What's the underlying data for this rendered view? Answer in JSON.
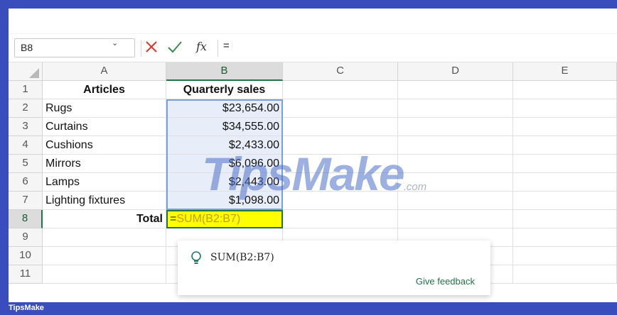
{
  "formula_bar": {
    "name_box": "B8",
    "formula": "="
  },
  "columns": [
    "A",
    "B",
    "C",
    "D",
    "E"
  ],
  "rows": [
    "1",
    "2",
    "3",
    "4",
    "5",
    "6",
    "7",
    "8",
    "9",
    "10",
    "11"
  ],
  "cells": {
    "A1": "Articles",
    "B1": "Quarterly sales",
    "A2": "Rugs",
    "B2": "$23,654.00",
    "A3": "Curtains",
    "B3": "$34,555.00",
    "A4": "Cushions",
    "B4": "$2,433.00",
    "A5": "Mirrors",
    "B5": "$6,096.00",
    "A6": "Lamps",
    "B6": "$2,443.00",
    "A7": "Lighting fixtures",
    "B7": "$1,098.00",
    "A8": "Total"
  },
  "active_cell": {
    "ref": "B8",
    "equals": "=",
    "formula": "SUM(B2:B7)"
  },
  "autocomplete": {
    "suggestion": "SUM(B2:B7)",
    "feedback": "Give feedback"
  },
  "watermark": {
    "brand": "TipsMake",
    "suffix": ".com"
  },
  "footer": {
    "brand": "TipsMake"
  },
  "colors": {
    "accent_green": "#217346",
    "highlight_yellow": "#ffff00",
    "frame_blue": "#3a4dbd"
  },
  "icons": [
    "cancel-icon",
    "enter-icon",
    "fx-icon",
    "lightbulb-icon",
    "chevron-down-icon"
  ]
}
